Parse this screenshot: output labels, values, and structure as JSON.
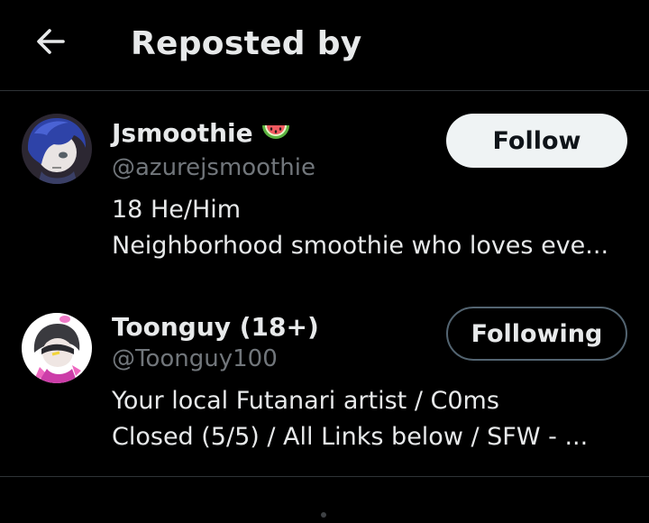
{
  "header": {
    "title": "Reposted by",
    "back_icon": "arrow-left-icon"
  },
  "colors": {
    "background": "#000000",
    "text_primary": "#e7e9ea",
    "text_secondary": "#71767b",
    "divider": "#2f3336",
    "follow_button_bg": "#eff3f4",
    "following_border": "#536471"
  },
  "users": [
    {
      "display_name": "Jsmoothie",
      "name_emoji": "watermelon-icon",
      "handle": "@azurejsmoothie",
      "bio_line_1": "18 He/Him",
      "bio_line_2": "Neighborhood smoothie who loves eve...",
      "button_label": "Follow",
      "following": false
    },
    {
      "display_name": "Toonguy (18+)",
      "handle": "@Toonguy100",
      "bio_line_1": "Your local Futanari artist  / C0ms",
      "bio_line_2": "Closed (5/5) / All Links below / SFW - ...",
      "button_label": "Following",
      "following": true
    }
  ]
}
